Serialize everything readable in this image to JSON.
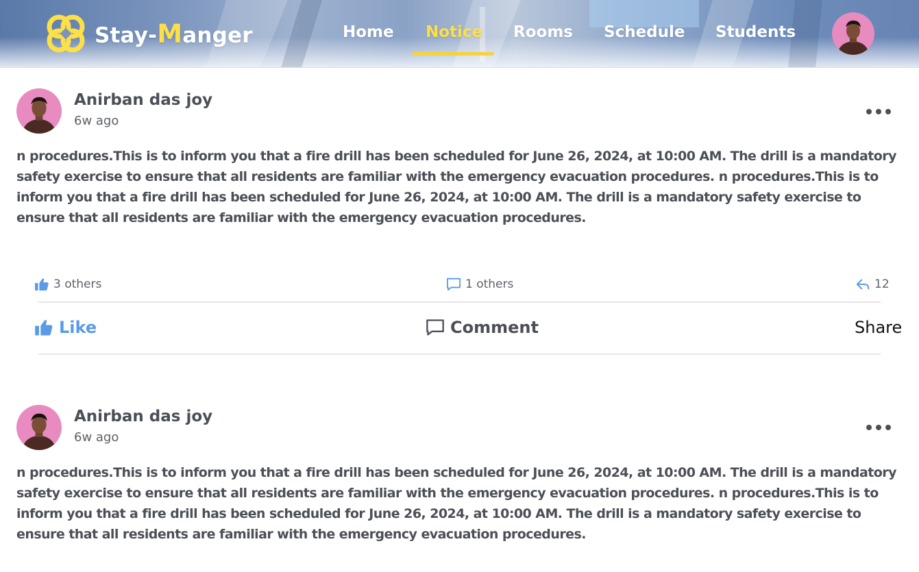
{
  "header": {
    "brand_prefix": "Stay-",
    "brand_accent": "M",
    "brand_suffix": "anger",
    "nav": [
      {
        "label": "Home",
        "active": false
      },
      {
        "label": "Notice",
        "active": true
      },
      {
        "label": "Rooms",
        "active": false
      },
      {
        "label": "Schedule",
        "active": false
      },
      {
        "label": "Students",
        "active": false
      }
    ],
    "logo_icon": "clover-logo-icon",
    "avatar_icon": "user-avatar"
  },
  "colors": {
    "accent_yellow": "#fde047",
    "like_blue": "#5b9be6",
    "text_dark": "#4b4f56",
    "avatar_pink": "#e88bc0"
  },
  "posts": [
    {
      "author": "Anirban das joy",
      "time": "6w ago",
      "text": "n procedures.This is to inform you that a fire drill has been scheduled for June 26, 2024, at 10:00 AM. The drill is a mandatory safety exercise to ensure that all residents are familiar with the emergency evacuation procedures. n procedures.This is to inform you that a fire drill has been scheduled for June 26, 2024, at 10:00 AM. The drill is a mandatory safety exercise to ensure that all residents are familiar with the emergency evacuation procedures.",
      "likes_text": "3 others",
      "comments_text": "1 others",
      "shares_count": "12",
      "like_label": "Like",
      "comment_label": "Comment",
      "share_label": "Share"
    },
    {
      "author": "Anirban das joy",
      "time": "6w ago",
      "text": "n procedures.This is to inform you that a fire drill has been scheduled for June 26, 2024, at 10:00 AM. The drill is a mandatory safety exercise to ensure that all residents are familiar with the emergency evacuation procedures. n procedures.This is to inform you that a fire drill has been scheduled for June 26, 2024, at 10:00 AM. The drill is a mandatory safety exercise to ensure that all residents are familiar with the emergency evacuation procedures."
    }
  ]
}
